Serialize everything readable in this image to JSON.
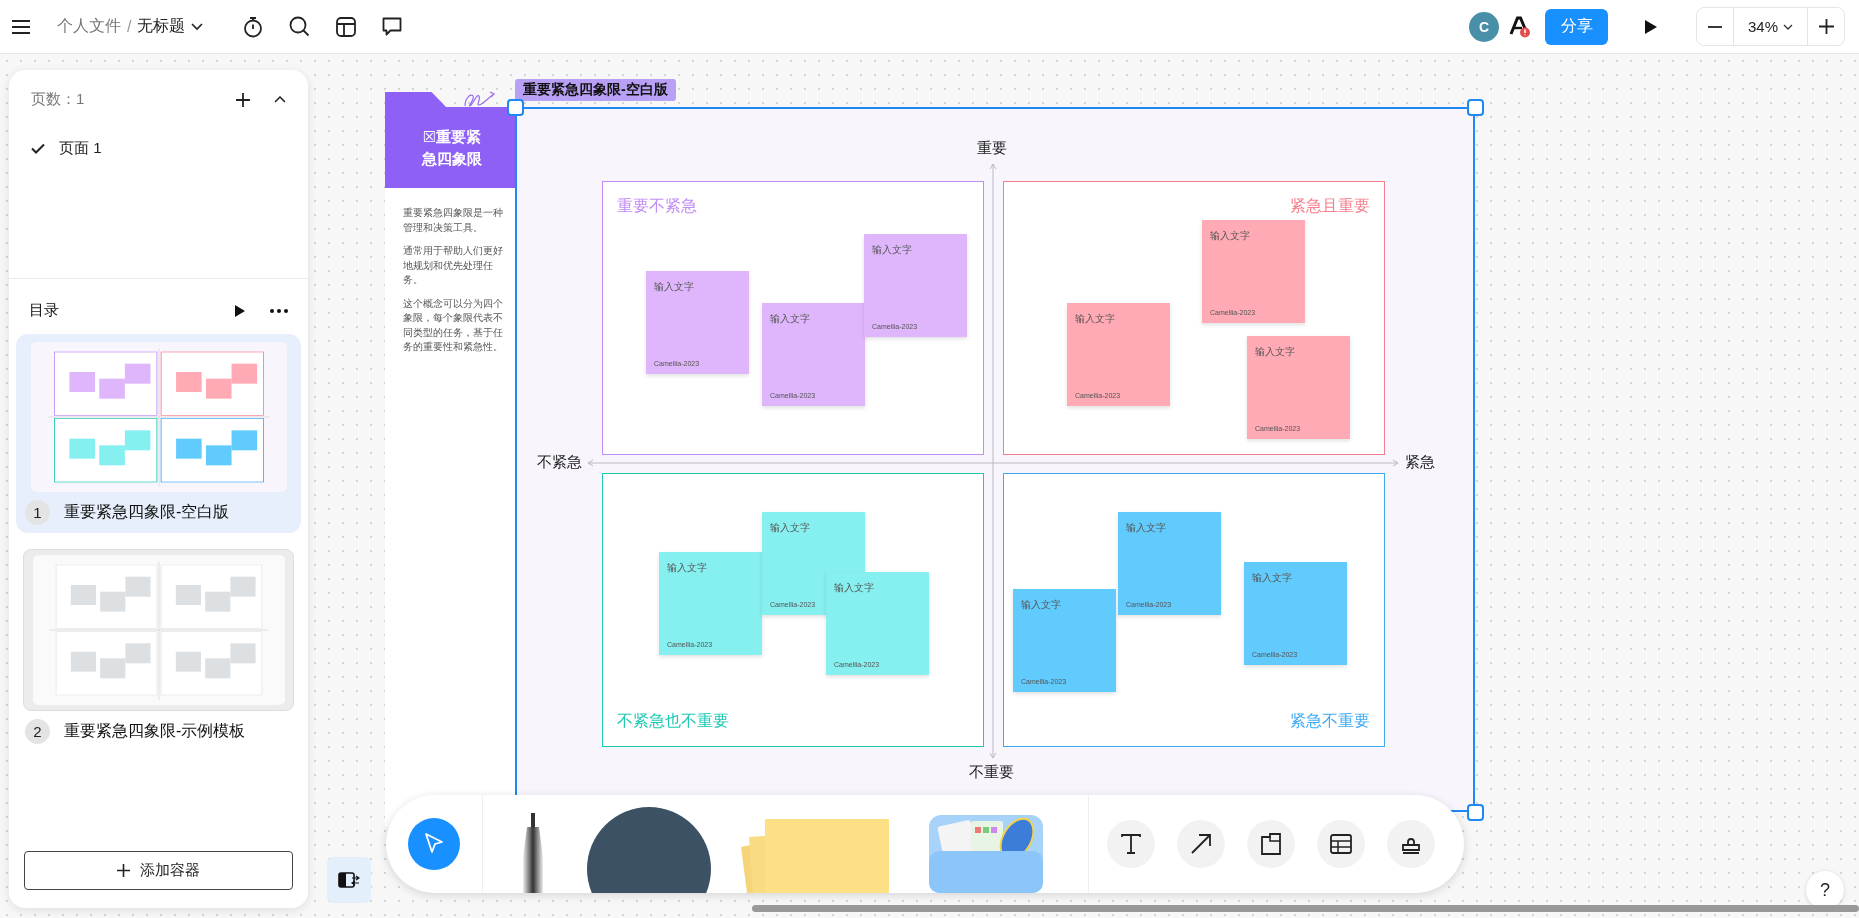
{
  "top_bar": {
    "breadcrumb_parent": "个人文件",
    "breadcrumb_separator": "/",
    "document_title": "无标题",
    "avatar": "C",
    "share_button": "分享",
    "zoom_level": "34%"
  },
  "pages_panel": {
    "count_label": "页数：1",
    "pages": [
      {
        "label": "页面 1",
        "selected": true
      }
    ]
  },
  "outline": {
    "title": "目录",
    "items": [
      {
        "index": "1",
        "label": "重要紧急四象限-空白版",
        "selected": true,
        "kind": "blank"
      },
      {
        "index": "2",
        "label": "重要紧急四象限-示例模板",
        "selected": false,
        "kind": "example"
      }
    ],
    "add_button": "添加容器"
  },
  "board": {
    "frame_label": "重要紧急四象限-空白版",
    "info_card": {
      "title": "☒重要紧急四象限",
      "paragraphs": [
        "重要紧急四象限是一种管理和决策工具。",
        "通常用于帮助人们更好地规划和优先处理任务。",
        "这个概念可以分为四个象限，每个象限代表不同类型的任务，基于任务的重要性和紧急性。"
      ]
    },
    "axes": {
      "top": "重要",
      "bottom": "不重要",
      "left": "不紧急",
      "right": "紧急"
    },
    "quadrants": [
      {
        "title": "重要不紧急",
        "color": "#c28cf7",
        "notes": [
          {
            "text": "输入文字",
            "author": "Camellia-2023",
            "color": "#dfb6fb"
          },
          {
            "text": "输入文字",
            "author": "Camellia-2023",
            "color": "#dfb6fb"
          },
          {
            "text": "输入文字",
            "author": "Camellia-2023",
            "color": "#dfb6fb"
          }
        ]
      },
      {
        "title": "紧急且重要",
        "color": "#f77f8d",
        "notes": [
          {
            "text": "输入文字",
            "author": "Camellia-2023",
            "color": "#ffaab4"
          },
          {
            "text": "输入文字",
            "author": "Camellia-2023",
            "color": "#ffaab4"
          },
          {
            "text": "输入文字",
            "author": "Camellia-2023",
            "color": "#ffaab4"
          }
        ]
      },
      {
        "title": "不紧急也不重要",
        "color": "#1ec9b4",
        "notes": [
          {
            "text": "输入文字",
            "author": "Camellia-2023",
            "color": "#86efef"
          },
          {
            "text": "输入文字",
            "author": "Camellia-2023",
            "color": "#86efef"
          },
          {
            "text": "输入文字",
            "author": "Camellia-2023",
            "color": "#86efef"
          }
        ]
      },
      {
        "title": "紧急不重要",
        "color": "#3fa9f2",
        "notes": [
          {
            "text": "输入文字",
            "author": "Camellia-2023",
            "color": "#62cbfd"
          },
          {
            "text": "输入文字",
            "author": "Camellia-2023",
            "color": "#62cbfd"
          },
          {
            "text": "输入文字",
            "author": "Camellia-2023",
            "color": "#62cbfd"
          }
        ]
      }
    ]
  },
  "tools": [
    {
      "kind": "select",
      "selected": true
    },
    {
      "kind": "text",
      "selected": false
    },
    {
      "kind": "arrow",
      "selected": false
    },
    {
      "kind": "frame",
      "selected": false
    },
    {
      "kind": "table",
      "selected": false
    },
    {
      "kind": "stamp",
      "selected": false
    }
  ],
  "help_button": "?"
}
